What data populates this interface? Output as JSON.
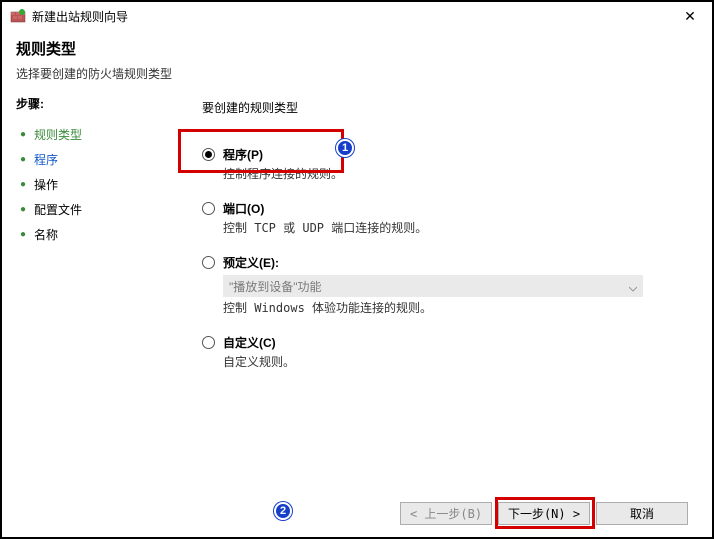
{
  "titlebar": {
    "title": "新建出站规则向导"
  },
  "header": {
    "title": "规则类型",
    "subtitle": "选择要创建的防火墙规则类型"
  },
  "sidebar": {
    "steps_label": "步骤:",
    "steps": [
      {
        "label": "规则类型"
      },
      {
        "label": "程序"
      },
      {
        "label": "操作"
      },
      {
        "label": "配置文件"
      },
      {
        "label": "名称"
      }
    ]
  },
  "content": {
    "heading": "要创建的规则类型",
    "options": [
      {
        "title": "程序(P)",
        "desc": "控制程序连接的规则。",
        "checked": true
      },
      {
        "title": "端口(O)",
        "desc": "控制 TCP 或 UDP 端口连接的规则。",
        "checked": false
      },
      {
        "title": "预定义(E):",
        "desc": "控制 Windows 体验功能连接的规则。",
        "checked": false,
        "dropdown": "\"播放到设备\"功能"
      },
      {
        "title": "自定义(C)",
        "desc": "自定义规则。",
        "checked": false
      }
    ]
  },
  "footer": {
    "back": "< 上一步(B)",
    "next": "下一步(N) >",
    "cancel": "取消"
  },
  "callouts": {
    "c1": "1",
    "c2": "2"
  }
}
